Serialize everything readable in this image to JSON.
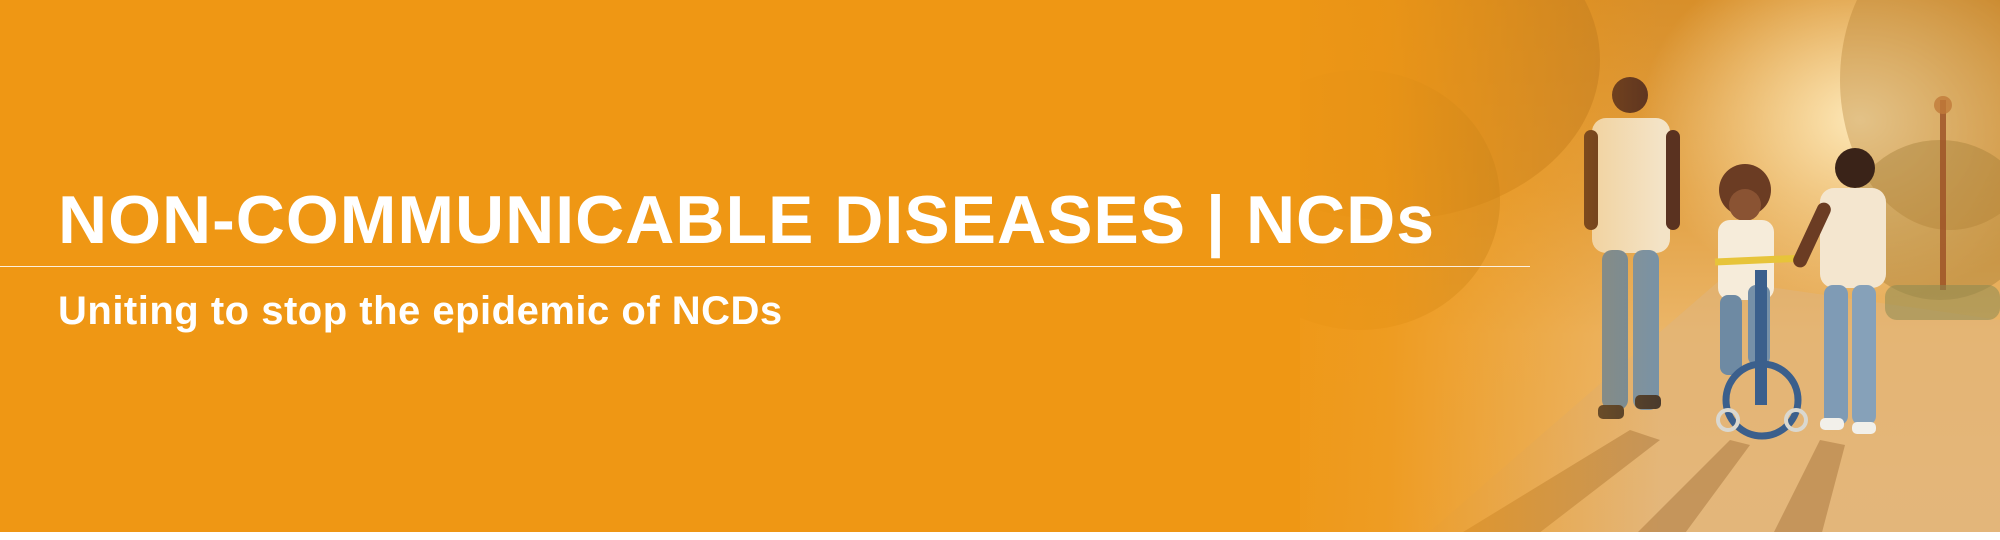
{
  "banner": {
    "title": "NON-COMMUNICABLE DISEASES | NCDs",
    "subtitle": "Uniting to stop the epidemic of NCDs",
    "background_color": "#EF9714",
    "text_color": "#FFFFFF",
    "photo_icon": "family-walking-photo"
  }
}
